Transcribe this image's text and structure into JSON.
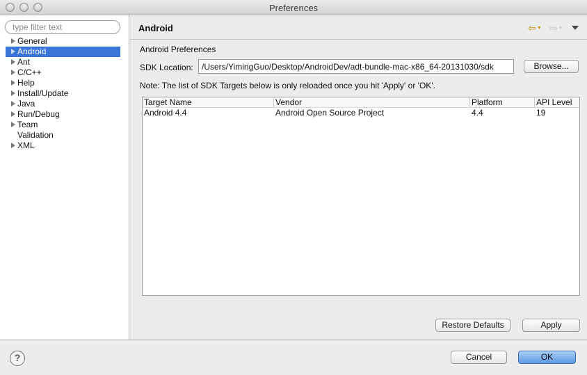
{
  "window": {
    "title": "Preferences"
  },
  "sidebar": {
    "filter_placeholder": "type filter text",
    "items": [
      {
        "label": "General",
        "expandable": true,
        "selected": false
      },
      {
        "label": "Android",
        "expandable": true,
        "selected": true
      },
      {
        "label": "Ant",
        "expandable": true,
        "selected": false
      },
      {
        "label": "C/C++",
        "expandable": true,
        "selected": false
      },
      {
        "label": "Help",
        "expandable": true,
        "selected": false
      },
      {
        "label": "Install/Update",
        "expandable": true,
        "selected": false
      },
      {
        "label": "Java",
        "expandable": true,
        "selected": false
      },
      {
        "label": "Run/Debug",
        "expandable": true,
        "selected": false
      },
      {
        "label": "Team",
        "expandable": true,
        "selected": false
      },
      {
        "label": "Validation",
        "expandable": false,
        "selected": false
      },
      {
        "label": "XML",
        "expandable": true,
        "selected": false
      }
    ]
  },
  "page": {
    "title": "Android",
    "section_label": "Android Preferences",
    "sdk_label": "SDK Location:",
    "sdk_value": "/Users/YimingGuo/Desktop/AndroidDev/adt-bundle-mac-x86_64-20131030/sdk",
    "browse_label": "Browse...",
    "note": "Note: The list of SDK Targets below is only reloaded once you hit 'Apply' or 'OK'.",
    "table": {
      "headers": [
        "Target Name",
        "Vendor",
        "Platform",
        "API Level"
      ],
      "rows": [
        [
          "Android 4.4",
          "Android Open Source Project",
          "4.4",
          "19"
        ]
      ]
    },
    "restore_defaults_label": "Restore Defaults",
    "apply_label": "Apply"
  },
  "nav": {
    "back_icon": "back-arrow-icon",
    "forward_icon": "forward-arrow-icon",
    "menu_icon": "view-menu-icon"
  },
  "footer": {
    "help_glyph": "?",
    "cancel_label": "Cancel",
    "ok_label": "OK"
  },
  "colors": {
    "selection": "#3875d7",
    "default_button": "#5f9ae4"
  }
}
